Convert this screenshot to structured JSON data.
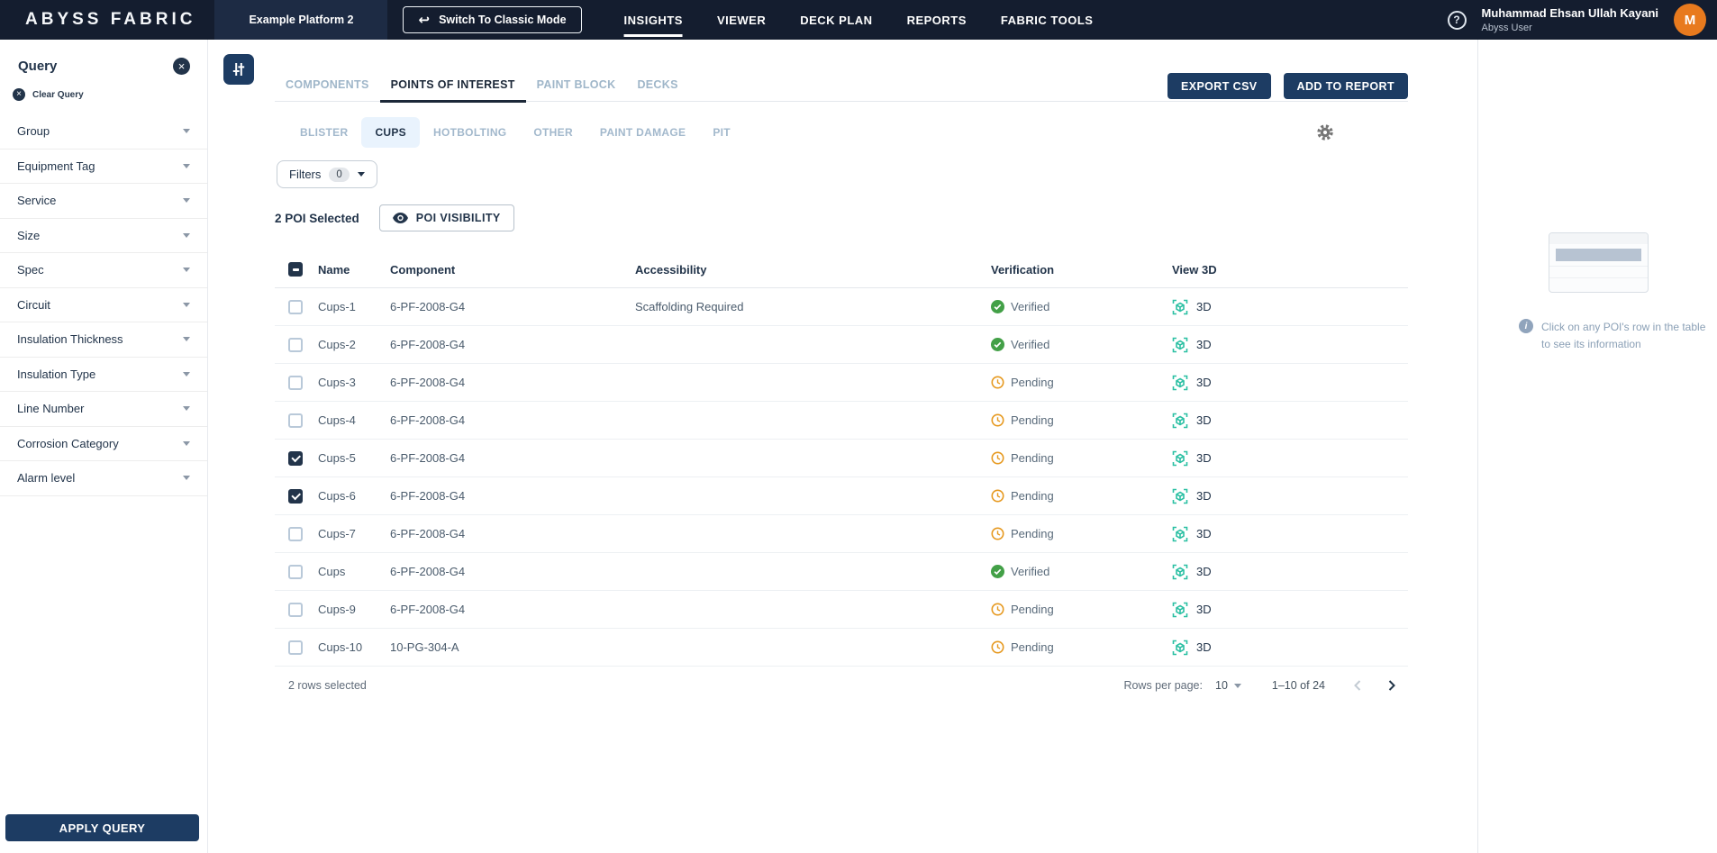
{
  "topnav": {
    "logo": "ABYSS FABRIC",
    "platform": "Example Platform 2",
    "switch_button": "Switch To Classic Mode",
    "nav_items": [
      {
        "label": "INSIGHTS",
        "active": true
      },
      {
        "label": "VIEWER",
        "active": false
      },
      {
        "label": "DECK PLAN",
        "active": false
      },
      {
        "label": "REPORTS",
        "active": false
      },
      {
        "label": "FABRIC TOOLS",
        "active": false
      }
    ],
    "user": {
      "name": "Muhammad Ehsan Ullah Kayani",
      "role": "Abyss User",
      "avatar_initial": "M"
    }
  },
  "sidebar": {
    "title": "Query",
    "clear_label": "Clear Query",
    "filters": [
      "Group",
      "Equipment Tag",
      "Service",
      "Size",
      "Spec",
      "Circuit",
      "Insulation Thickness",
      "Insulation Type",
      "Line Number",
      "Corrosion Category",
      "Alarm level"
    ],
    "apply_button": "APPLY QUERY"
  },
  "main": {
    "tabs": [
      {
        "label": "COMPONENTS",
        "active": false
      },
      {
        "label": "POINTS OF INTEREST",
        "active": true
      },
      {
        "label": "PAINT BLOCK",
        "active": false
      },
      {
        "label": "DECKS",
        "active": false
      }
    ],
    "subtabs": [
      {
        "label": "BLISTER",
        "active": false
      },
      {
        "label": "CUPS",
        "active": true
      },
      {
        "label": "HOTBOLTING",
        "active": false
      },
      {
        "label": "OTHER",
        "active": false
      },
      {
        "label": "PAINT DAMAGE",
        "active": false
      },
      {
        "label": "PIT",
        "active": false
      }
    ],
    "filters_button": {
      "label": "Filters",
      "count": "0"
    },
    "selection_label": "2 POI Selected",
    "visibility_button": "POI VISIBILITY",
    "export_button": "EXPORT CSV",
    "add_report_button": "ADD TO REPORT"
  },
  "table": {
    "columns": {
      "name": "Name",
      "component": "Component",
      "accessibility": "Accessibility",
      "verification": "Verification",
      "view3d": "View 3D"
    },
    "view_label": "3D",
    "rows": [
      {
        "name": "Cups-1",
        "component": "6-PF-2008-G4",
        "accessibility": "Scaffolding Required",
        "verification": "Verified",
        "pending": false,
        "checked": false
      },
      {
        "name": "Cups-2",
        "component": "6-PF-2008-G4",
        "accessibility": "",
        "verification": "Verified",
        "pending": false,
        "checked": false
      },
      {
        "name": "Cups-3",
        "component": "6-PF-2008-G4",
        "accessibility": "",
        "verification": "Pending",
        "pending": true,
        "checked": false
      },
      {
        "name": "Cups-4",
        "component": "6-PF-2008-G4",
        "accessibility": "",
        "verification": "Pending",
        "pending": true,
        "checked": false
      },
      {
        "name": "Cups-5",
        "component": "6-PF-2008-G4",
        "accessibility": "",
        "verification": "Pending",
        "pending": true,
        "checked": true
      },
      {
        "name": "Cups-6",
        "component": "6-PF-2008-G4",
        "accessibility": "",
        "verification": "Pending",
        "pending": true,
        "checked": true
      },
      {
        "name": "Cups-7",
        "component": "6-PF-2008-G4",
        "accessibility": "",
        "verification": "Pending",
        "pending": true,
        "checked": false
      },
      {
        "name": "Cups",
        "component": "6-PF-2008-G4",
        "accessibility": "",
        "verification": "Verified",
        "pending": false,
        "checked": false
      },
      {
        "name": "Cups-9",
        "component": "6-PF-2008-G4",
        "accessibility": "",
        "verification": "Pending",
        "pending": true,
        "checked": false
      },
      {
        "name": "Cups-10",
        "component": "10-PG-304-A",
        "accessibility": "",
        "verification": "Pending",
        "pending": true,
        "checked": false
      }
    ],
    "footer": {
      "selected": "2 rows selected",
      "rows_per_page_label": "Rows per page:",
      "rows_per_page": "10",
      "range": "1–10 of 24"
    }
  },
  "right_panel": {
    "hint": "Click on any POI's row in the table to see its information"
  },
  "colors": {
    "nav_bg": "#141d2f",
    "navy_accent": "#1d3c63",
    "verified_green": "#43a047",
    "pending_amber": "#e6991f",
    "view3d_teal": "#2bc0a3",
    "avatar_orange": "#e87a1e",
    "subtab_active_bg": "#e9f3fd"
  }
}
